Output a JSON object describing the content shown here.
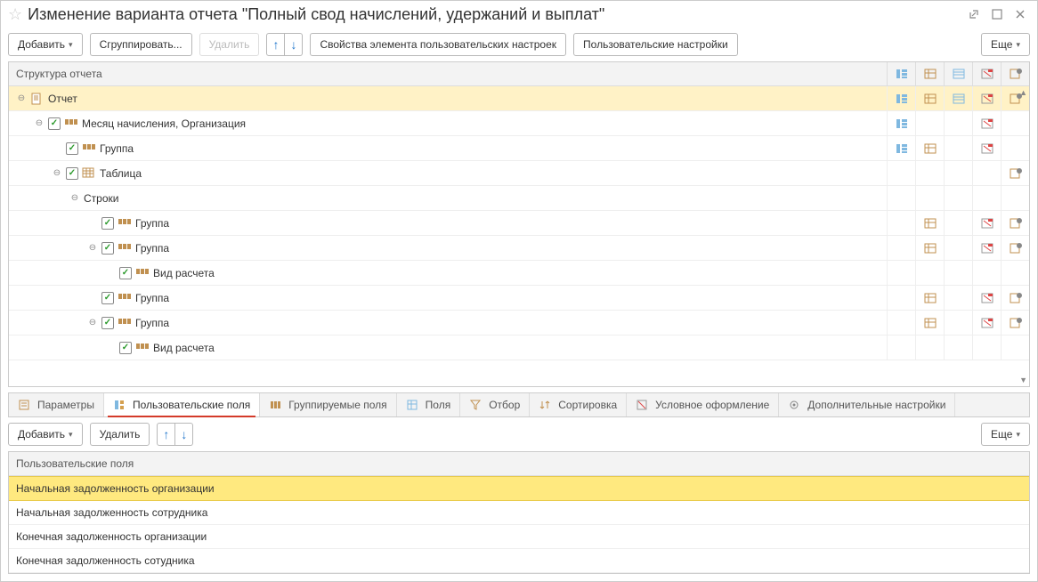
{
  "title": "Изменение варианта отчета \"Полный свод начислений, удержаний и выплат\"",
  "toolbar": {
    "add": "Добавить",
    "group": "Сгруппировать...",
    "delete": "Удалить",
    "custom_element_props": "Свойства элемента пользовательских настроек",
    "user_settings": "Пользовательские настройки",
    "more": "Еще"
  },
  "tree": {
    "header": "Структура отчета",
    "rows": [
      {
        "id": "r0",
        "indent": 0,
        "exp": "minus",
        "chk": false,
        "type": "doc",
        "label": "Отчет",
        "highlight": true,
        "icons": [
          "i1",
          "i2",
          "i3",
          "i4",
          "i5"
        ]
      },
      {
        "id": "r1",
        "indent": 1,
        "exp": "minus",
        "chk": true,
        "type": "grp",
        "label": "Месяц начисления, Организация",
        "icons": [
          "i1",
          "",
          "",
          "i4",
          ""
        ]
      },
      {
        "id": "r2",
        "indent": 2,
        "exp": "none",
        "chk": true,
        "type": "grp",
        "label": "Группа",
        "icons": [
          "i1",
          "i2",
          "",
          "i4",
          ""
        ]
      },
      {
        "id": "r3",
        "indent": 2,
        "exp": "minus",
        "chk": true,
        "type": "tbl",
        "label": "Таблица",
        "icons": [
          "",
          "",
          "",
          "",
          "i5"
        ]
      },
      {
        "id": "r4",
        "indent": 3,
        "exp": "minus",
        "chk": false,
        "type": "none",
        "label": "Строки",
        "icons": [
          "",
          "",
          "",
          "",
          ""
        ]
      },
      {
        "id": "r5",
        "indent": 4,
        "exp": "none",
        "chk": true,
        "type": "grp",
        "label": "Группа",
        "icons": [
          "",
          "i2",
          "",
          "i4",
          "i5"
        ]
      },
      {
        "id": "r6",
        "indent": 4,
        "exp": "minus",
        "chk": true,
        "type": "grp",
        "label": "Группа",
        "icons": [
          "",
          "i2",
          "",
          "i4",
          "i5"
        ]
      },
      {
        "id": "r7",
        "indent": 5,
        "exp": "none",
        "chk": true,
        "type": "grp",
        "label": "Вид расчета",
        "icons": [
          "",
          "",
          "",
          "",
          ""
        ]
      },
      {
        "id": "r8",
        "indent": 4,
        "exp": "none",
        "chk": true,
        "type": "grp",
        "label": "Группа",
        "icons": [
          "",
          "i2",
          "",
          "i4",
          "i5"
        ]
      },
      {
        "id": "r9",
        "indent": 4,
        "exp": "minus",
        "chk": true,
        "type": "grp",
        "label": "Группа",
        "icons": [
          "",
          "i2",
          "",
          "i4",
          "i5"
        ]
      },
      {
        "id": "r10",
        "indent": 5,
        "exp": "none",
        "chk": true,
        "type": "grp",
        "label": "Вид расчета",
        "icons": [
          "",
          "",
          "",
          "",
          ""
        ]
      }
    ]
  },
  "tabs": [
    {
      "id": "t0",
      "label": "Параметры"
    },
    {
      "id": "t1",
      "label": "Пользовательские поля",
      "active": true
    },
    {
      "id": "t2",
      "label": "Группируемые поля"
    },
    {
      "id": "t3",
      "label": "Поля"
    },
    {
      "id": "t4",
      "label": "Отбор"
    },
    {
      "id": "t5",
      "label": "Сортировка"
    },
    {
      "id": "t6",
      "label": "Условное оформление"
    },
    {
      "id": "t7",
      "label": "Дополнительные настройки"
    }
  ],
  "toolbar2": {
    "add": "Добавить",
    "delete": "Удалить",
    "more": "Еще"
  },
  "lowlist": {
    "header": "Пользовательские поля",
    "rows": [
      {
        "label": "Начальная задолженность организации",
        "selected": true
      },
      {
        "label": "Начальная задолженность сотрудника"
      },
      {
        "label": "Конечная задолженность организации"
      },
      {
        "label": "Конечная задолженность сотудника"
      }
    ]
  }
}
